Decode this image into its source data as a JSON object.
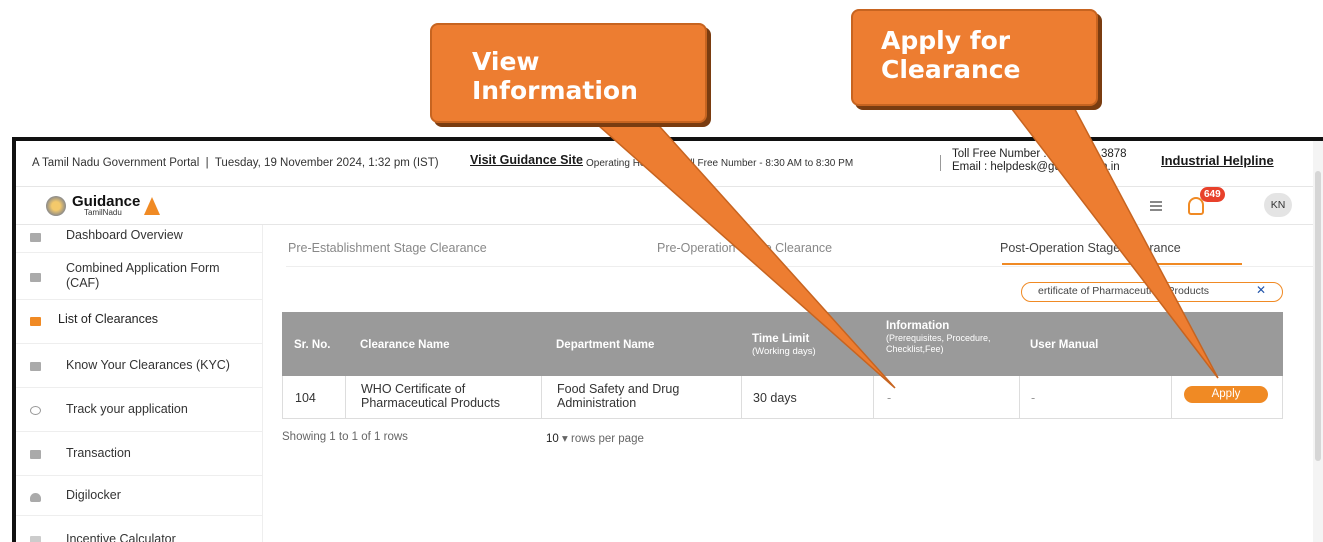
{
  "callouts": {
    "view_information": "View\nInformation",
    "apply_for_clearance": "Apply for\nClearance"
  },
  "topbar": {
    "portal_text": "A Tamil Nadu Government Portal",
    "datetime": "Tuesday, 19 November 2024, 1:32 pm (IST)",
    "visit_link": "Visit Guidance Site",
    "operating_hours": "Operating Hours For Toll Free Number - 8:30 AM to 8:30 PM",
    "toll_free_label": "Toll Free Number : 1800 258 3878",
    "email_label": "Email : helpdesk@guidance.tn.in",
    "helpline_link": "Industrial Helpline"
  },
  "logo": {
    "title": "Guidance",
    "subtitle": "TamilNadu"
  },
  "header": {
    "notification_count": "649",
    "user_initials": "KN"
  },
  "sidebar": {
    "items": [
      {
        "label": "Dashboard Overview"
      },
      {
        "label": "Combined Application Form (CAF)"
      },
      {
        "label": "List of Clearances"
      },
      {
        "label": "Know Your Clearances (KYC)"
      },
      {
        "label": "Track your application"
      },
      {
        "label": "Transaction"
      },
      {
        "label": "Digilocker"
      },
      {
        "label": "Incentive Calculator"
      }
    ]
  },
  "tabs": [
    {
      "label": "Pre-Establishment Stage Clearance"
    },
    {
      "label": "Pre-Operation Stage Clearance"
    },
    {
      "label": "Post-Operation Stage Clearance",
      "active": true
    }
  ],
  "search": {
    "value": "ertificate of Pharmaceutical Products"
  },
  "table": {
    "headers": {
      "sr_no": "Sr. No.",
      "clearance_name": "Clearance Name",
      "department_name": "Department Name",
      "time_limit": "Time Limit",
      "time_limit_sub": "(Working days)",
      "information": "Information",
      "information_sub": "(Prerequisites, Procedure, Checklist,Fee)",
      "user_manual": "User Manual"
    },
    "rows": [
      {
        "sr_no": "104",
        "clearance_name": "WHO Certificate of Pharmaceutical Products",
        "department_name": "Food Safety and Drug Administration",
        "time_limit": "30 days",
        "information": "-",
        "user_manual": "-",
        "action": "Apply"
      }
    ]
  },
  "pagination": {
    "showing": "Showing 1 to 1 of 1 rows",
    "per_page_value": "10",
    "per_page_label": "rows per page"
  },
  "colors": {
    "accent": "#f08a24",
    "callout": "#ed7d31",
    "table_header": "#9a9a9a"
  }
}
